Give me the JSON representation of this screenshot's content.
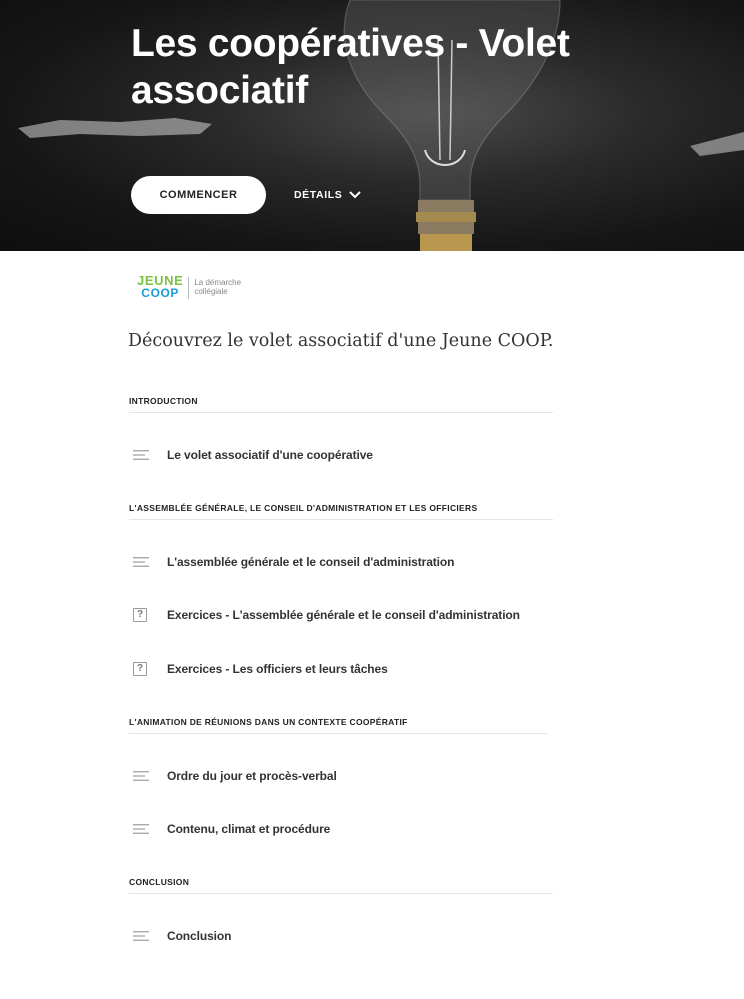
{
  "hero": {
    "title": "Les coopératives - Volet associatif",
    "start_label": "COMMENCER",
    "details_label": "DÉTAILS"
  },
  "logo": {
    "line1": "JEUNE",
    "line2": "COOP",
    "tagline_1": "La démarche",
    "tagline_2": "collégiale"
  },
  "description": "Découvrez le volet associatif d'une Jeune COOP.",
  "sections": [
    {
      "title": "INTRODUCTION",
      "lessons": [
        {
          "label": "Le volet associatif d'une coopérative",
          "icon": "text-lines-icon"
        }
      ]
    },
    {
      "title": "L'ASSEMBLÉE GÉNÉRALE, LE CONSEIL D'ADMINISTRATION ET LES OFFICIERS",
      "lessons": [
        {
          "label": "L'assemblée générale et le conseil d'administration",
          "icon": "text-lines-icon"
        },
        {
          "label": "Exercices - L'assemblée générale et le conseil d'administration",
          "icon": "quiz-icon"
        },
        {
          "label": "Exercices - Les officiers et leurs tâches",
          "icon": "quiz-icon"
        }
      ]
    },
    {
      "title": "L'ANIMATION DE RÉUNIONS DANS UN CONTEXTE COOPÉRATIF",
      "lessons": [
        {
          "label": "Ordre du jour et procès-verbal",
          "icon": "text-lines-icon"
        },
        {
          "label": "Contenu, climat et procédure",
          "icon": "text-lines-icon"
        }
      ]
    },
    {
      "title": "CONCLUSION",
      "lessons": [
        {
          "label": "Conclusion",
          "icon": "text-lines-icon"
        }
      ]
    }
  ],
  "colors": {
    "logo_green": "#7cc242",
    "logo_blue": "#1a9bd7",
    "hero_background": "#1a1a1a"
  },
  "quiz_glyph": "?"
}
